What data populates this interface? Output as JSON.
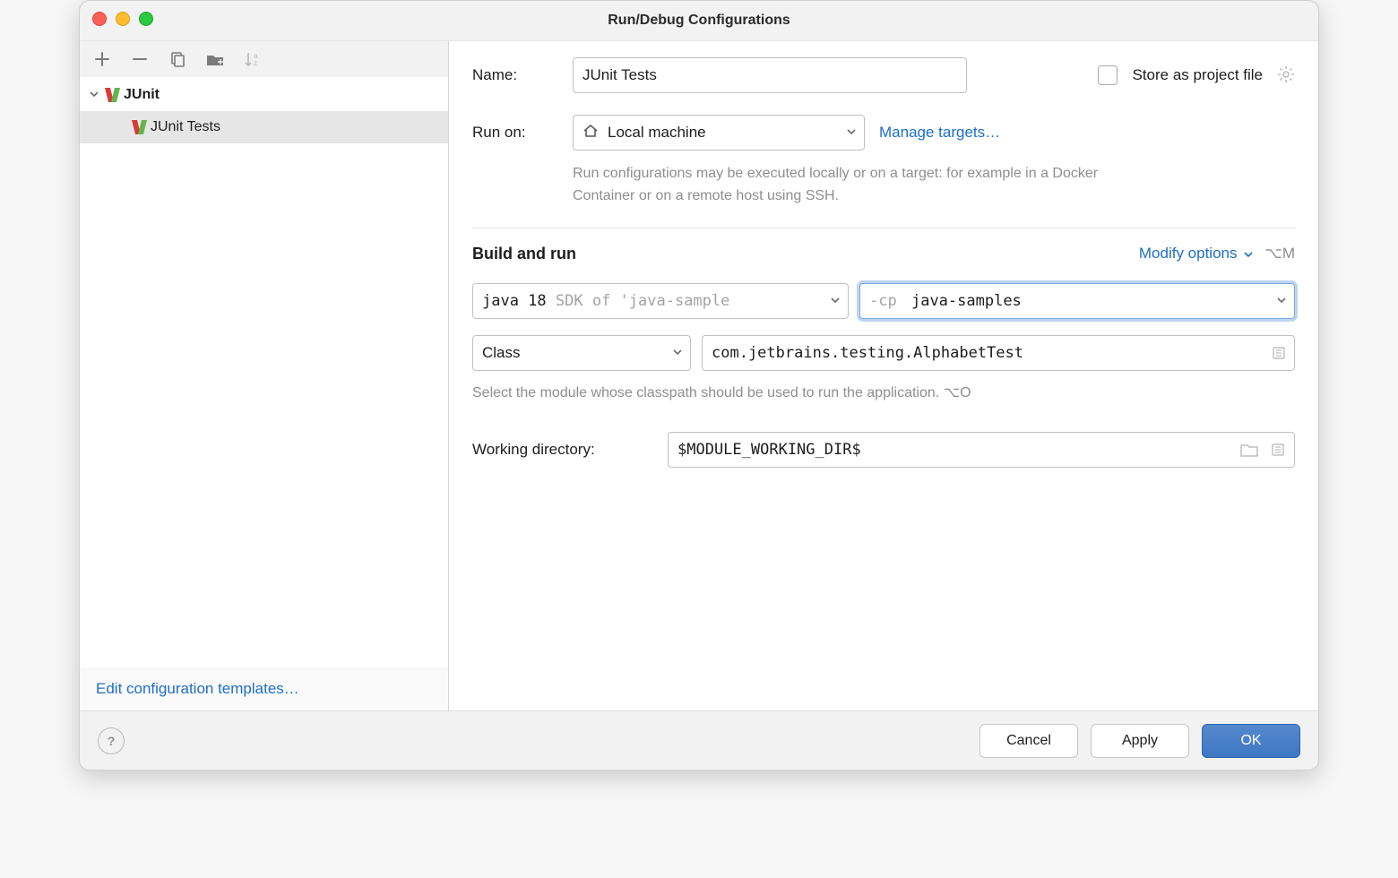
{
  "window": {
    "title": "Run/Debug Configurations"
  },
  "sidebar": {
    "tree": {
      "root": {
        "label": "JUnit"
      },
      "child": {
        "label": "JUnit Tests"
      }
    },
    "templates_link": "Edit configuration templates…"
  },
  "form": {
    "name_label": "Name:",
    "name_value": "JUnit Tests",
    "store_label": "Store as project file",
    "run_on_label": "Run on:",
    "run_on_value": "Local machine",
    "manage_targets": "Manage targets…",
    "run_on_hint": "Run configurations may be executed locally or on a target: for example in a Docker Container or on a remote host using SSH.",
    "section_title": "Build and run",
    "modify_options": "Modify options",
    "modify_shortcut": "⌥M",
    "jdk_prefix": "java 18",
    "jdk_suffix": "SDK of 'java-sample",
    "cp_prefix": "-cp",
    "cp_value": "java-samples",
    "test_kind": "Class",
    "test_class": "com.jetbrains.testing.AlphabetTest",
    "classpath_hint": "Select the module whose classpath should be used to run the application. ⌥O",
    "working_dir_label": "Working directory:",
    "working_dir_value": "$MODULE_WORKING_DIR$"
  },
  "footer": {
    "cancel": "Cancel",
    "apply": "Apply",
    "ok": "OK"
  }
}
